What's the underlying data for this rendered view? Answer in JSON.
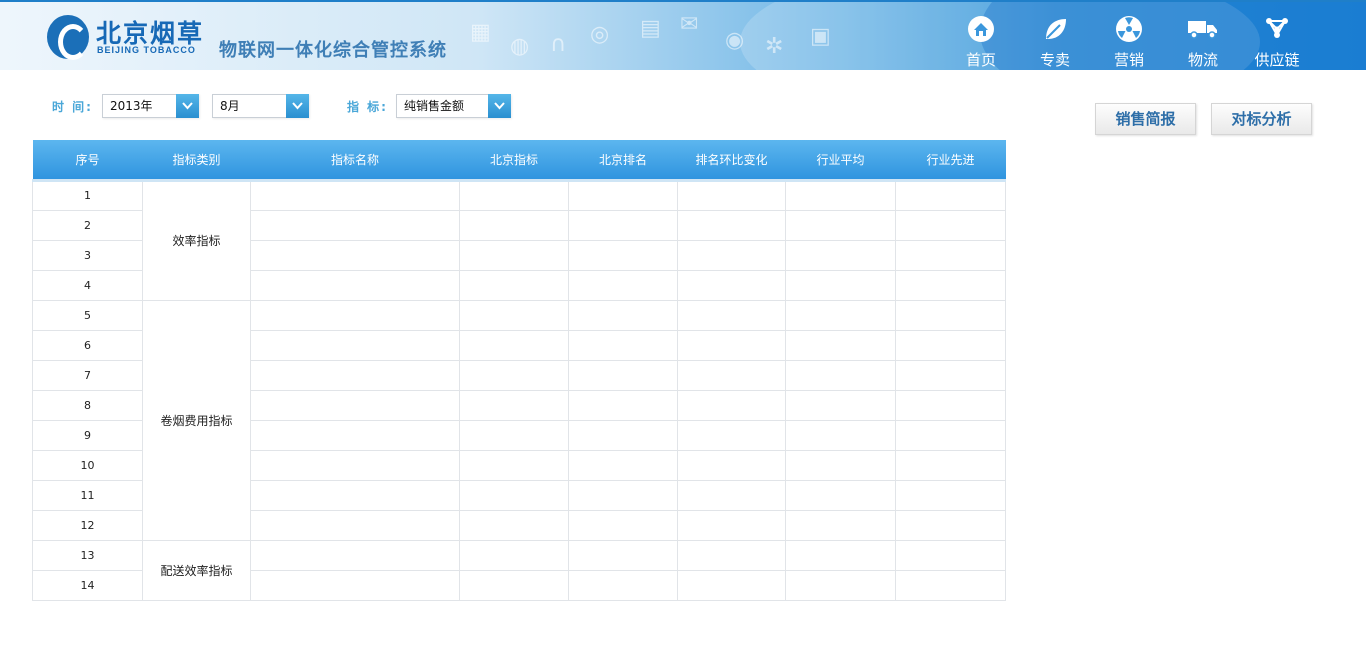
{
  "header": {
    "logo_cn": "北京烟草",
    "logo_en": "BEIJING TOBACCO",
    "system_title": "物联网一体化综合管控系统",
    "nav": [
      {
        "label": "首页",
        "icon": "home-icon"
      },
      {
        "label": "专卖",
        "icon": "leaf-icon"
      },
      {
        "label": "营销",
        "icon": "radiation-icon"
      },
      {
        "label": "物流",
        "icon": "truck-icon"
      },
      {
        "label": "供应链",
        "icon": "network-icon"
      }
    ]
  },
  "filters": {
    "time_label": "时 间:",
    "year_value": "2013年",
    "month_value": "8月",
    "indicator_label": "指 标:",
    "indicator_value": "纯销售金额"
  },
  "buttons": {
    "sales_report": "销售简报",
    "benchmark_analysis": "对标分析"
  },
  "table": {
    "columns": [
      "序号",
      "指标类别",
      "指标名称",
      "北京指标",
      "北京排名",
      "排名环比变化",
      "行业平均",
      "行业先进"
    ],
    "rows": [
      "1",
      "2",
      "3",
      "4",
      "5",
      "6",
      "7",
      "8",
      "9",
      "10",
      "11",
      "12",
      "13",
      "14"
    ],
    "categories": [
      {
        "label": "效率指标",
        "start": 0,
        "span": 4
      },
      {
        "label": "卷烟费用指标",
        "start": 4,
        "span": 8
      },
      {
        "label": "配送效率指标",
        "start": 12,
        "span": 2
      }
    ]
  },
  "colors": {
    "accent": "#2f94df",
    "label_blue": "#4aa7d8",
    "button_text": "#2d6ea8"
  }
}
